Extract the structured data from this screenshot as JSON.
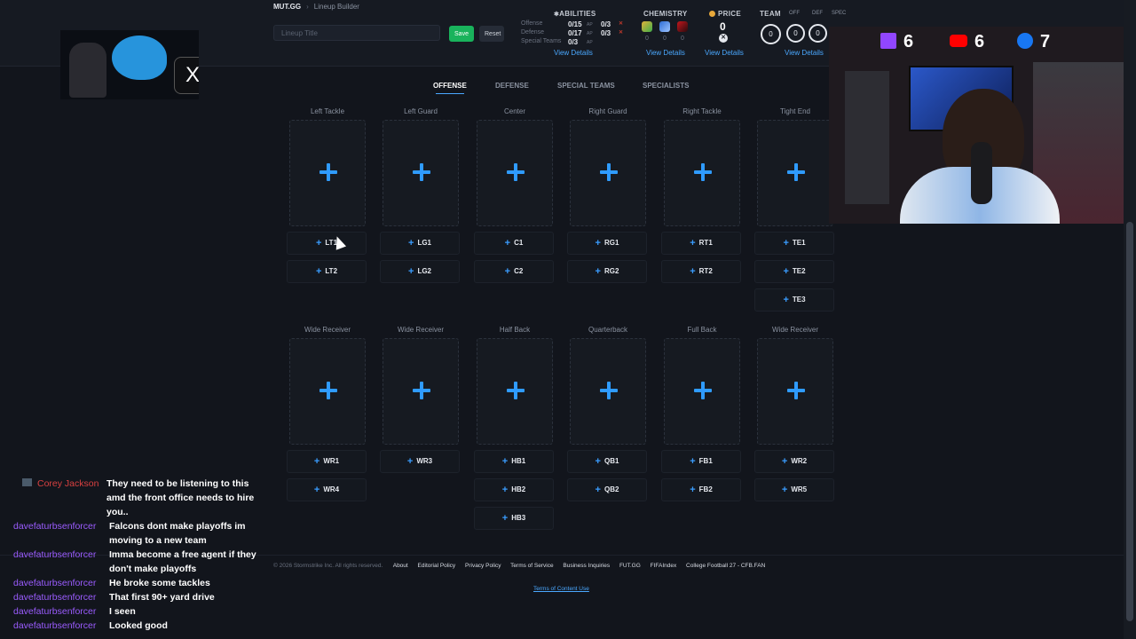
{
  "header": {
    "site": "MUT.GG",
    "page": "Lineup Builder",
    "title_placeholder": "Lineup Title",
    "save": "Save",
    "reset": "Reset"
  },
  "abilities": {
    "heading": "ABILITIES",
    "rows": [
      {
        "label": "Offense",
        "ap": "0/15",
        "ap_unit": "AP",
        "slots": "0/3"
      },
      {
        "label": "Defense",
        "ap": "0/17",
        "ap_unit": "AP",
        "slots": "0/3"
      },
      {
        "label": "Special Teams",
        "ap": "0/3",
        "ap_unit": "AP",
        "slots": ""
      }
    ],
    "view": "View Details"
  },
  "chemistry": {
    "heading": "CHEMISTRY",
    "values": [
      "0",
      "0",
      "0"
    ],
    "view": "View Details"
  },
  "price": {
    "heading": "PRICE",
    "value": "0",
    "view": "View Details"
  },
  "team": {
    "heading": "TEAM",
    "sub": [
      "OFF",
      "DEF",
      "SPEC"
    ],
    "values": [
      "0",
      "0",
      "0"
    ],
    "view": "View Details"
  },
  "tabs": [
    "OFFENSE",
    "DEFENSE",
    "SPECIAL TEAMS",
    "SPECIALISTS"
  ],
  "active_tab": "OFFENSE",
  "row1": {
    "positions": [
      "Left Tackle",
      "Left Guard",
      "Center",
      "Right Guard",
      "Right Tackle",
      "Tight End"
    ],
    "slots": [
      [
        "LT1",
        "LT2"
      ],
      [
        "LG1",
        "LG2"
      ],
      [
        "C1",
        "C2"
      ],
      [
        "RG1",
        "RG2"
      ],
      [
        "RT1",
        "RT2"
      ],
      [
        "TE1",
        "TE2",
        "TE3"
      ]
    ]
  },
  "row2": {
    "positions": [
      "Wide Receiver",
      "Wide Receiver",
      "Half Back",
      "Quarterback",
      "Full Back",
      "Wide Receiver"
    ],
    "slots": [
      [
        "WR1",
        "WR4"
      ],
      [
        "WR3"
      ],
      [
        "HB1",
        "HB2",
        "HB3"
      ],
      [
        "QB1",
        "QB2"
      ],
      [
        "FB1",
        "FB2"
      ],
      [
        "WR2",
        "WR5"
      ]
    ]
  },
  "footer": {
    "copyright": "© 2026 Stormstrike Inc. All rights reserved.",
    "links": [
      "About",
      "Editorial Policy",
      "Privacy Policy",
      "Terms of Service",
      "Business Inquiries",
      "FUT.GG",
      "FIFAIndex",
      "College Football 27 - CFB.FAN"
    ],
    "terms": "Terms of Content Use"
  },
  "stream_overlay": {
    "socials": [
      {
        "icon": "twitch-icon",
        "count": "6",
        "color": "#9146ff"
      },
      {
        "icon": "youtube-icon",
        "count": "6",
        "color": "#ff0000"
      },
      {
        "icon": "facebook-icon",
        "count": "7",
        "color": "#1877f2"
      }
    ],
    "chat": [
      {
        "user": "Corey Jackson",
        "msg": "They need to be listening to this amd the front office needs to hire you..",
        "color": "#d94040"
      },
      {
        "user": "davefaturbsenforcer",
        "msg": "Falcons dont make playoffs im moving to a new team",
        "color": "#9b5cff"
      },
      {
        "user": "davefaturbsenforcer",
        "msg": "Imma become a free agent if they don't make playoffs",
        "color": "#9b5cff"
      },
      {
        "user": "davefaturbsenforcer",
        "msg": "He broke some tackles",
        "color": "#9b5cff"
      },
      {
        "user": "davefaturbsenforcer",
        "msg": "That first 90+ yard drive",
        "color": "#9b5cff"
      },
      {
        "user": "davefaturbsenforcer",
        "msg": "I seen",
        "color": "#9b5cff"
      },
      {
        "user": "davefaturbsenforcer",
        "msg": "Looked good",
        "color": "#9b5cff"
      }
    ]
  },
  "colors": {
    "accent": "#2f9bff",
    "save": "#19b35c",
    "background": "#12151c"
  }
}
